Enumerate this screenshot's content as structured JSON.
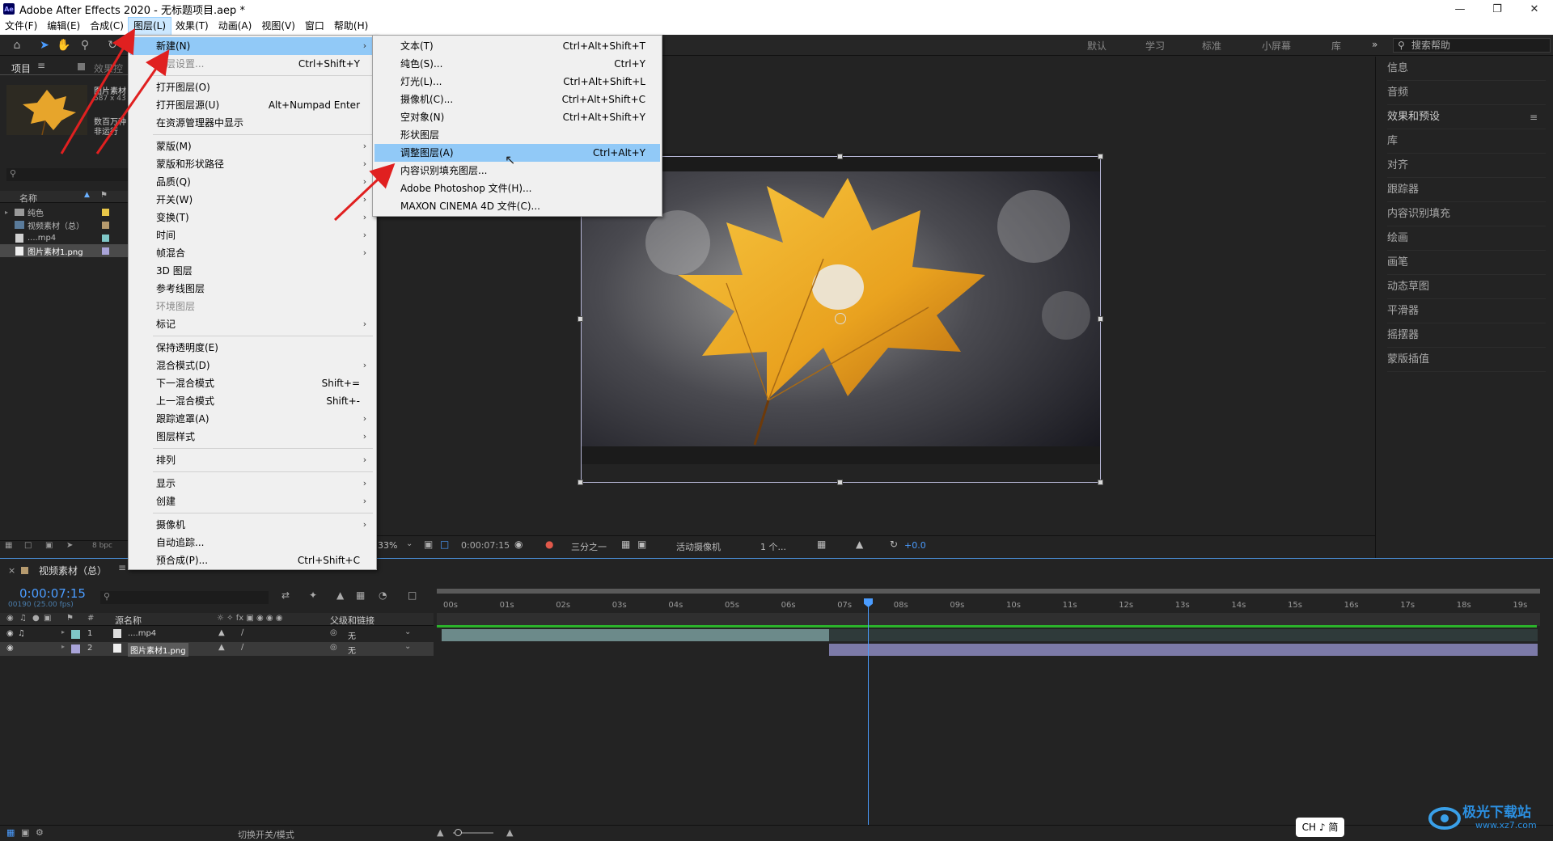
{
  "window": {
    "title": "Adobe After Effects 2020 - 无标题项目.aep *",
    "app_badge": "Ae"
  },
  "menubar": [
    "文件(F)",
    "编辑(E)",
    "合成(C)",
    "图层(L)",
    "效果(T)",
    "动画(A)",
    "视图(V)",
    "窗口",
    "帮助(H)"
  ],
  "workspaces": [
    "默认",
    "学习",
    "标准",
    "小屏幕",
    "库"
  ],
  "help_search": "搜索帮助",
  "project": {
    "tab": "项目",
    "tab2": "效果控",
    "thumb_name": "图片素材",
    "thumb_dims": "587 x 43",
    "thumb_extra": "数百万种",
    "thumb_extra2": "非运行",
    "col_name": "名称",
    "items": [
      {
        "name": "纯色",
        "kind": "folder"
      },
      {
        "name": "视频素材（总）",
        "kind": "comp"
      },
      {
        "name": "....mp4",
        "kind": "video"
      },
      {
        "name": "图片素材1.png",
        "kind": "image"
      }
    ],
    "bpc": "8 bpc"
  },
  "right_panel": [
    "信息",
    "音频",
    "效果和预设",
    "库",
    "对齐",
    "跟踪器",
    "内容识别填充",
    "绘画",
    "画笔",
    "动态草图",
    "平滑器",
    "摇摆器",
    "蒙版插值"
  ],
  "layer_menu": {
    "items": [
      {
        "label": "新建(N)",
        "shortcut": "",
        "arrow": true,
        "highlight": true
      },
      {
        "label": "图层设置...",
        "shortcut": "Ctrl+Shift+Y",
        "disabled": true
      },
      {
        "label": "打开图层(O)",
        "shortcut": ""
      },
      {
        "label": "打开图层源(U)",
        "shortcut": "Alt+Numpad Enter"
      },
      {
        "label": "在资源管理器中显示",
        "shortcut": ""
      },
      {
        "label": "蒙版(M)",
        "arrow": true
      },
      {
        "label": "蒙版和形状路径",
        "arrow": true
      },
      {
        "label": "品质(Q)",
        "arrow": true
      },
      {
        "label": "开关(W)",
        "arrow": true
      },
      {
        "label": "变换(T)",
        "arrow": true
      },
      {
        "label": "时间",
        "arrow": true
      },
      {
        "label": "帧混合",
        "arrow": true
      },
      {
        "label": "3D 图层"
      },
      {
        "label": "参考线图层"
      },
      {
        "label": "环境图层",
        "disabled": true
      },
      {
        "label": "标记",
        "arrow": true
      },
      {
        "label": "保持透明度(E)"
      },
      {
        "label": "混合模式(D)",
        "arrow": true
      },
      {
        "label": "下一混合模式",
        "shortcut": "Shift+="
      },
      {
        "label": "上一混合模式",
        "shortcut": "Shift+-"
      },
      {
        "label": "跟踪遮罩(A)",
        "arrow": true
      },
      {
        "label": "图层样式",
        "arrow": true
      },
      {
        "label": "排列",
        "arrow": true
      },
      {
        "label": "显示",
        "arrow": true
      },
      {
        "label": "创建",
        "arrow": true
      },
      {
        "label": "摄像机",
        "arrow": true
      },
      {
        "label": "自动追踪..."
      },
      {
        "label": "预合成(P)...",
        "shortcut": "Ctrl+Shift+C"
      }
    ]
  },
  "new_menu": {
    "items": [
      {
        "label": "文本(T)",
        "shortcut": "Ctrl+Alt+Shift+T"
      },
      {
        "label": "纯色(S)...",
        "shortcut": "Ctrl+Y"
      },
      {
        "label": "灯光(L)...",
        "shortcut": "Ctrl+Alt+Shift+L"
      },
      {
        "label": "摄像机(C)...",
        "shortcut": "Ctrl+Alt+Shift+C"
      },
      {
        "label": "空对象(N)",
        "shortcut": "Ctrl+Alt+Shift+Y"
      },
      {
        "label": "形状图层",
        "shortcut": ""
      },
      {
        "label": "调整图层(A)",
        "shortcut": "Ctrl+Alt+Y",
        "highlight": true
      },
      {
        "label": "内容识别填充图层...",
        "shortcut": ""
      },
      {
        "label": "Adobe Photoshop 文件(H)...",
        "shortcut": ""
      },
      {
        "label": "MAXON CINEMA 4D 文件(C)...",
        "shortcut": ""
      }
    ]
  },
  "viewer_bar": {
    "zoom": "33%",
    "time": "0:00:07:15",
    "resolution": "三分之一",
    "camera": "活动摄像机",
    "views": "1 个...",
    "exposure": "+0.0"
  },
  "timeline": {
    "comp_tab": "视频素材（总）",
    "timecode": "0:00:07:15",
    "frame_info": "00190 (25.00 fps)",
    "col_source": "源名称",
    "col_parent": "父级和链接",
    "ruler": [
      "00s",
      "01s",
      "02s",
      "03s",
      "04s",
      "05s",
      "06s",
      "07s",
      "08s",
      "09s",
      "10s",
      "11s",
      "12s",
      "13s",
      "14s",
      "15s",
      "16s",
      "17s",
      "18s",
      "19s"
    ],
    "layers": [
      {
        "num": "1",
        "name": "....mp4",
        "parent": "无",
        "color": "#7fc7c7"
      },
      {
        "num": "2",
        "name": "图片素材1.png",
        "parent": "无",
        "color": "#a9a4d8"
      }
    ]
  },
  "status": {
    "toggle": "切换开关/模式",
    "ime": "CH ♪ 简",
    "watermark": "极光下载站",
    "watermark_url": "www.xz7.com"
  }
}
